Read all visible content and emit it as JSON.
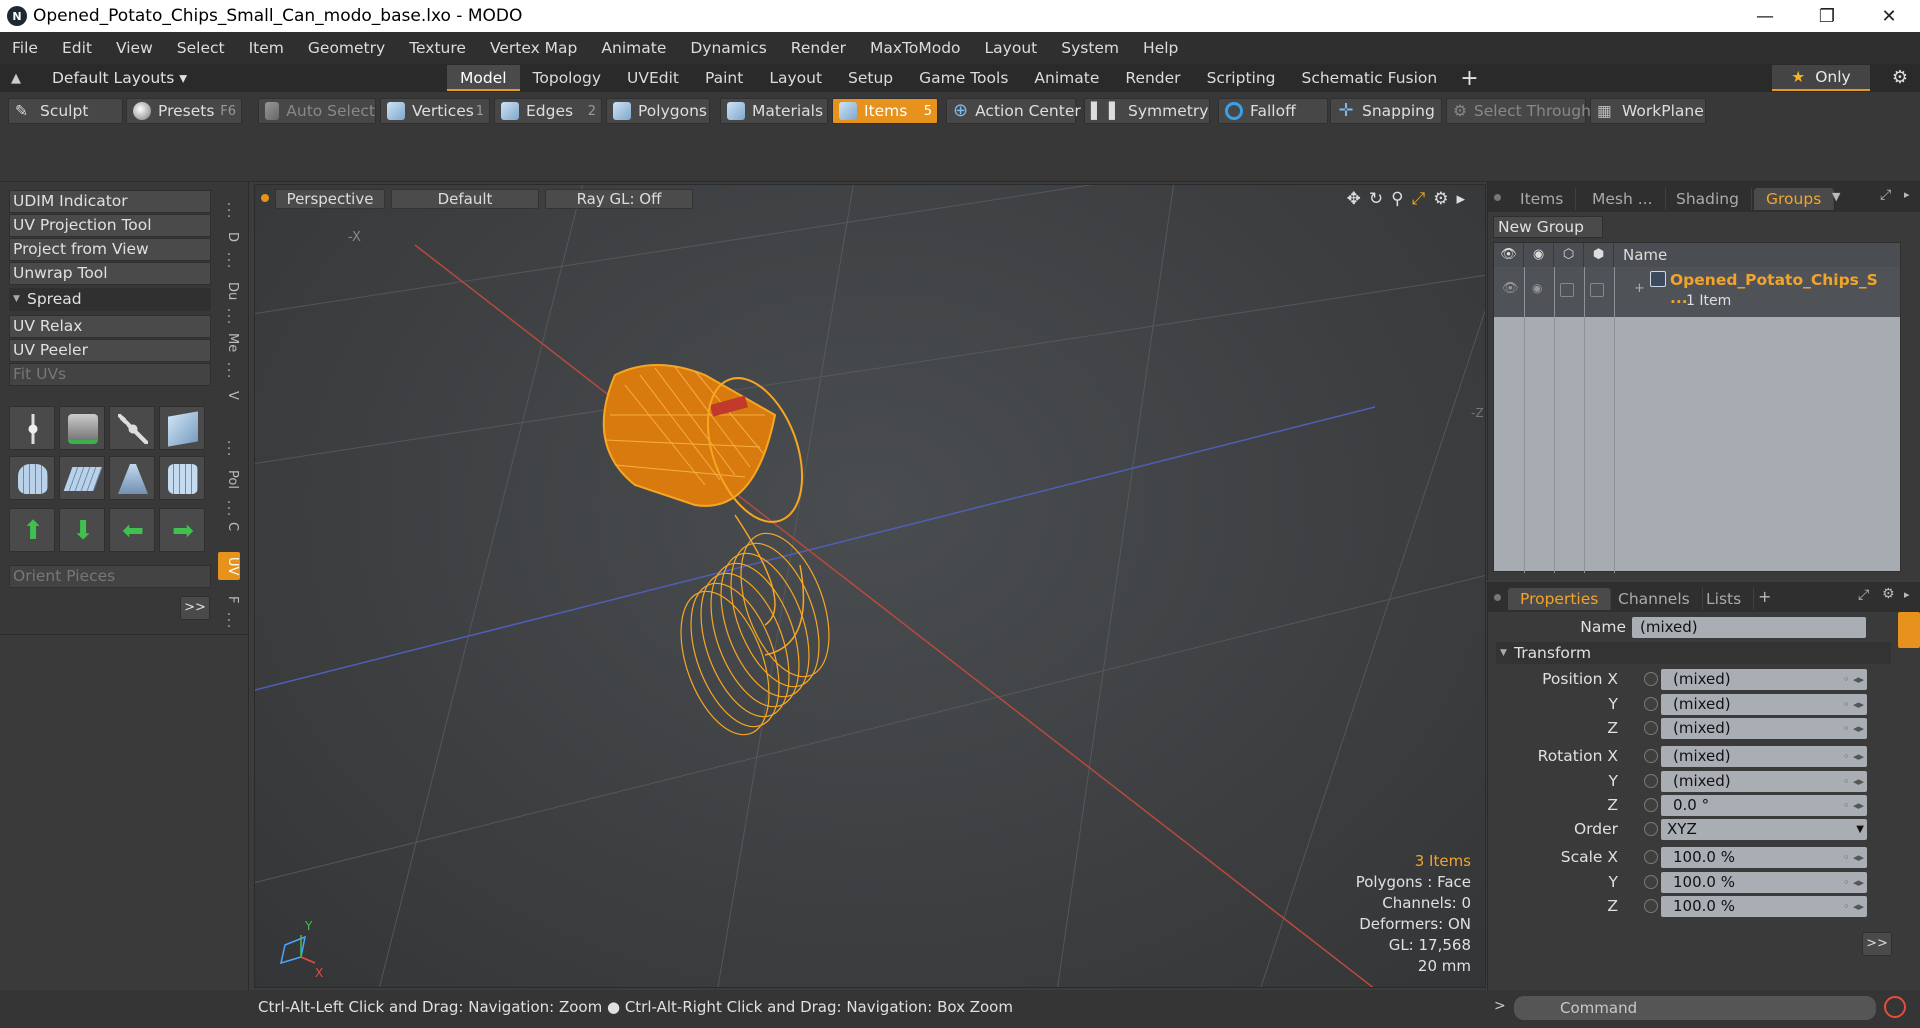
{
  "window": {
    "title": "Opened_Potato_Chips_Small_Can_modo_base.lxo - MODO",
    "app_icon": "N",
    "minimize": "—",
    "maximize": "❐",
    "close": "✕"
  },
  "menu": [
    "File",
    "Edit",
    "View",
    "Select",
    "Item",
    "Geometry",
    "Texture",
    "Vertex Map",
    "Animate",
    "Dynamics",
    "Render",
    "MaxToModo",
    "Layout",
    "System",
    "Help"
  ],
  "layout_bar": {
    "layouts_label": "Default Layouts ▾",
    "tabs": [
      "Model",
      "Topology",
      "UVEdit",
      "Paint",
      "Layout",
      "Setup",
      "Game Tools",
      "Animate",
      "Render",
      "Scripting",
      "Schematic Fusion"
    ],
    "active_tab": "Model",
    "plus": "+",
    "only_label": "Only",
    "star": "★",
    "gear": "⚙"
  },
  "toolbar": {
    "sculpt": "Sculpt",
    "presets": "Presets",
    "presets_key": "F6",
    "auto_select": "Auto Select",
    "vertices": "Vertices",
    "vertices_num": "1",
    "edges": "Edges",
    "edges_num": "2",
    "polygons": "Polygons",
    "materials": "Materials",
    "items": "Items",
    "items_num": "5",
    "action_center": "Action Center",
    "symmetry": "Symmetry",
    "falloff": "Falloff",
    "snapping": "Snapping",
    "select_through": "Select Through",
    "workplane": "WorkPlane"
  },
  "left_panel": {
    "udim": "UDIM Indicator",
    "uv_projection": "UV Projection Tool",
    "project_view": "Project from View",
    "unwrap": "Unwrap Tool",
    "spread": "Spread",
    "uv_relax": "UV Relax",
    "uv_peeler": "UV Peeler",
    "fit_uvs": "Fit UVs",
    "orient": "Orient Pieces",
    "more": ">>",
    "vtabs": [
      "D",
      "Du",
      "Me",
      "V",
      "Pol",
      "C",
      "UV",
      "F"
    ],
    "active_vtab": "UV"
  },
  "viewport": {
    "view": "Perspective",
    "shading": "Default",
    "raygl": "Ray GL: Off",
    "info": {
      "items": "3 Items",
      "polygons": "Polygons : Face",
      "channels": "Channels: 0",
      "deformers": "Deformers: ON",
      "gl": "GL: 17,568",
      "size": "20 mm"
    },
    "axis_labels": {
      "x": "X",
      "y": "Y",
      "neg_x": "-X",
      "z_edge": "-Z"
    }
  },
  "status": "Ctrl-Alt-Left Click and Drag: Navigation: Zoom ● Ctrl-Alt-Right Click and Drag: Navigation: Box Zoom",
  "groups_panel": {
    "tabs": [
      "Items",
      "Mesh ...",
      "Shading",
      "Groups"
    ],
    "active_tab": "Groups",
    "new_group": "New Group",
    "name_col": "Name",
    "group_name": "Opened_Potato_Chips_S ...",
    "group_sub": "1 Item"
  },
  "properties_panel": {
    "tabs": [
      "Properties",
      "Channels",
      "Lists"
    ],
    "active_tab": "Properties",
    "name_label": "Name",
    "name_value": "(mixed)",
    "transform": "Transform",
    "rows": [
      {
        "label": "Position X",
        "value": "(mixed)"
      },
      {
        "label": "Y",
        "value": "(mixed)"
      },
      {
        "label": "Z",
        "value": "(mixed)"
      },
      {
        "label": "Rotation X",
        "value": "(mixed)"
      },
      {
        "label": "Y",
        "value": "(mixed)"
      },
      {
        "label": "Z",
        "value": "0.0 °"
      },
      {
        "label": "Order",
        "value": "XYZ"
      },
      {
        "label": "Scale X",
        "value": "100.0 %"
      },
      {
        "label": "Y",
        "value": "100.0 %"
      },
      {
        "label": "Z",
        "value": "100.0 %"
      }
    ],
    "more": ">>"
  },
  "command": {
    "placeholder": "Command",
    "prompt": ">"
  },
  "colors": {
    "accent": "#e7921c",
    "mesh": "#f5a623"
  }
}
